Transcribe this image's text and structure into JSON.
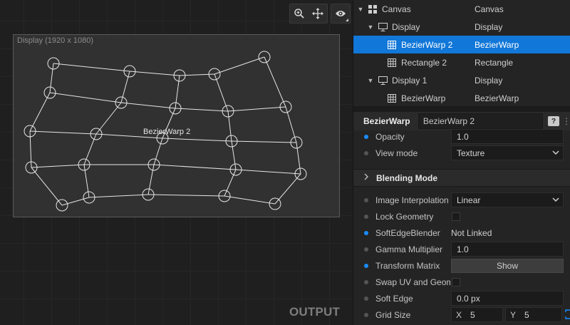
{
  "toolbar": {
    "zoom_icon": "zoom-in-icon",
    "move_icon": "move-icon",
    "visibility_icon": "eye-icon"
  },
  "viewport": {
    "display_frame_label": "Display (1920 x 1080)",
    "warp_label": "BezierWarp 2",
    "output_label": "OUTPUT"
  },
  "tree": {
    "rows": [
      {
        "name": "Canvas",
        "type": "Canvas",
        "icon": "grid-icon",
        "expanded": true,
        "selected": false
      },
      {
        "name": "Display",
        "type": "Display",
        "icon": "monitor-icon",
        "expanded": true,
        "selected": false
      },
      {
        "name": "BezierWarp 2",
        "type": "BezierWarp",
        "icon": "grid-icon",
        "selected": true
      },
      {
        "name": "Rectangle 2",
        "type": "Rectangle",
        "icon": "grid-icon",
        "selected": false
      },
      {
        "name": "Display 1",
        "type": "Display",
        "icon": "monitor-icon",
        "expanded": true,
        "selected": false
      },
      {
        "name": "BezierWarp",
        "type": "BezierWarp",
        "icon": "grid-icon",
        "selected": false
      }
    ]
  },
  "inspector": {
    "type_label": "BezierWarp",
    "name_value": "BezierWarp 2",
    "help_label": "?",
    "more_label": "⋮",
    "opacity": {
      "label": "Opacity",
      "value": "1.0"
    },
    "view_mode": {
      "label": "View mode",
      "value": "Texture"
    },
    "blending_section": "Blending Mode",
    "image_interpolation": {
      "label": "Image Interpolation",
      "value": "Linear"
    },
    "lock_geometry": {
      "label": "Lock Geometry",
      "checked": false
    },
    "soft_edge_blender": {
      "label": "SoftEdgeBlender",
      "value": "Not Linked"
    },
    "gamma_multiplier": {
      "label": "Gamma Multiplier",
      "value": "1.0"
    },
    "transform_matrix": {
      "label": "Transform Matrix",
      "button": "Show"
    },
    "swap_uv": {
      "label": "Swap UV and Geome",
      "checked": false
    },
    "soft_edge": {
      "label": "Soft Edge",
      "value": "0.0 px"
    },
    "grid_size": {
      "label": "Grid Size",
      "x_axis": "X",
      "x_value": "5",
      "y_axis": "Y",
      "y_value": "5"
    }
  },
  "colors": {
    "selection": "#1177d8",
    "active_dot": "#1a8cff"
  }
}
